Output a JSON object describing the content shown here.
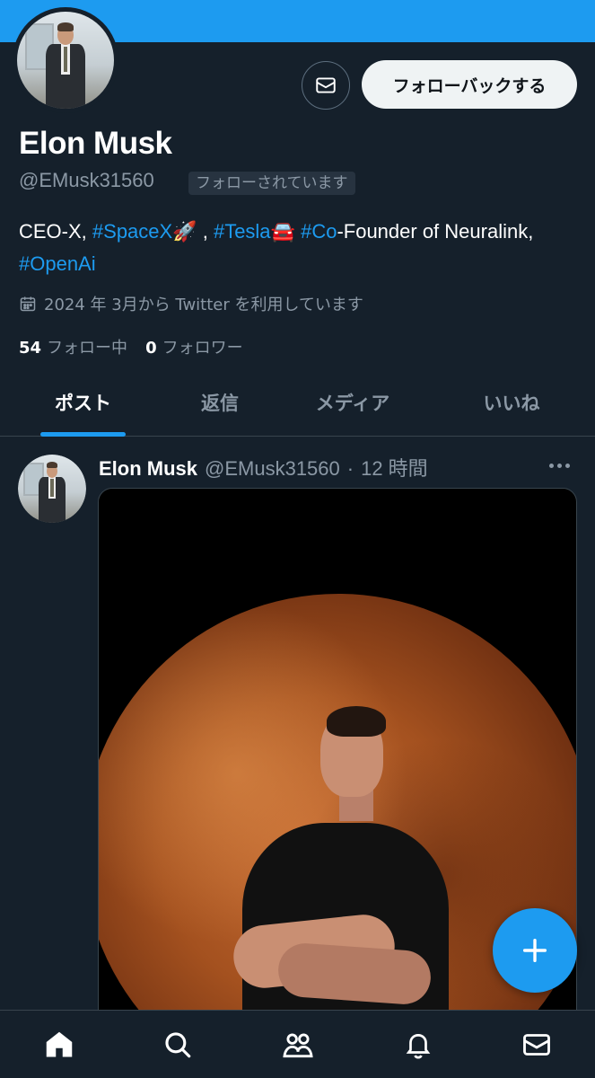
{
  "profile": {
    "name": "Elon Musk",
    "handle": "@EMusk31560",
    "follows_you": "フォローされています",
    "follow_back_label": "フォローバックする",
    "bio": {
      "p1": "CEO-X, ",
      "link1": "#SpaceX",
      "emoji1": "🚀",
      "p2": " , ",
      "link2": "#Tesla",
      "emoji2": "🚘",
      "p3": " ",
      "link3": "#Co",
      "p4": "-Founder of Neuralink, ",
      "link4": "#OpenAi"
    },
    "joined": "2024 年 3月から Twitter を利用しています",
    "following_count": "54",
    "following_label": "フォロー中",
    "followers_count": "0",
    "followers_label": "フォロワー"
  },
  "tabs": [
    {
      "label": "ポスト",
      "active": true
    },
    {
      "label": "返信",
      "active": false
    },
    {
      "label": "メディア",
      "active": false
    },
    {
      "label": "いいね",
      "active": false
    }
  ],
  "post": {
    "author_name": "Elon Musk",
    "author_handle": "@EMusk31560",
    "separator": "·",
    "time": "12 時間",
    "icons": {
      "more": "more-horizontal-icon"
    }
  },
  "nav": {
    "items": [
      {
        "icon": "home-icon",
        "active": true
      },
      {
        "icon": "search-icon",
        "active": false
      },
      {
        "icon": "communities-icon",
        "active": false
      },
      {
        "icon": "bell-icon",
        "active": false
      },
      {
        "icon": "mail-icon",
        "active": false
      }
    ]
  },
  "colors": {
    "background": "#15202b",
    "accent": "#1d9bf0",
    "muted": "#8b98a5",
    "divider": "#38444d"
  }
}
